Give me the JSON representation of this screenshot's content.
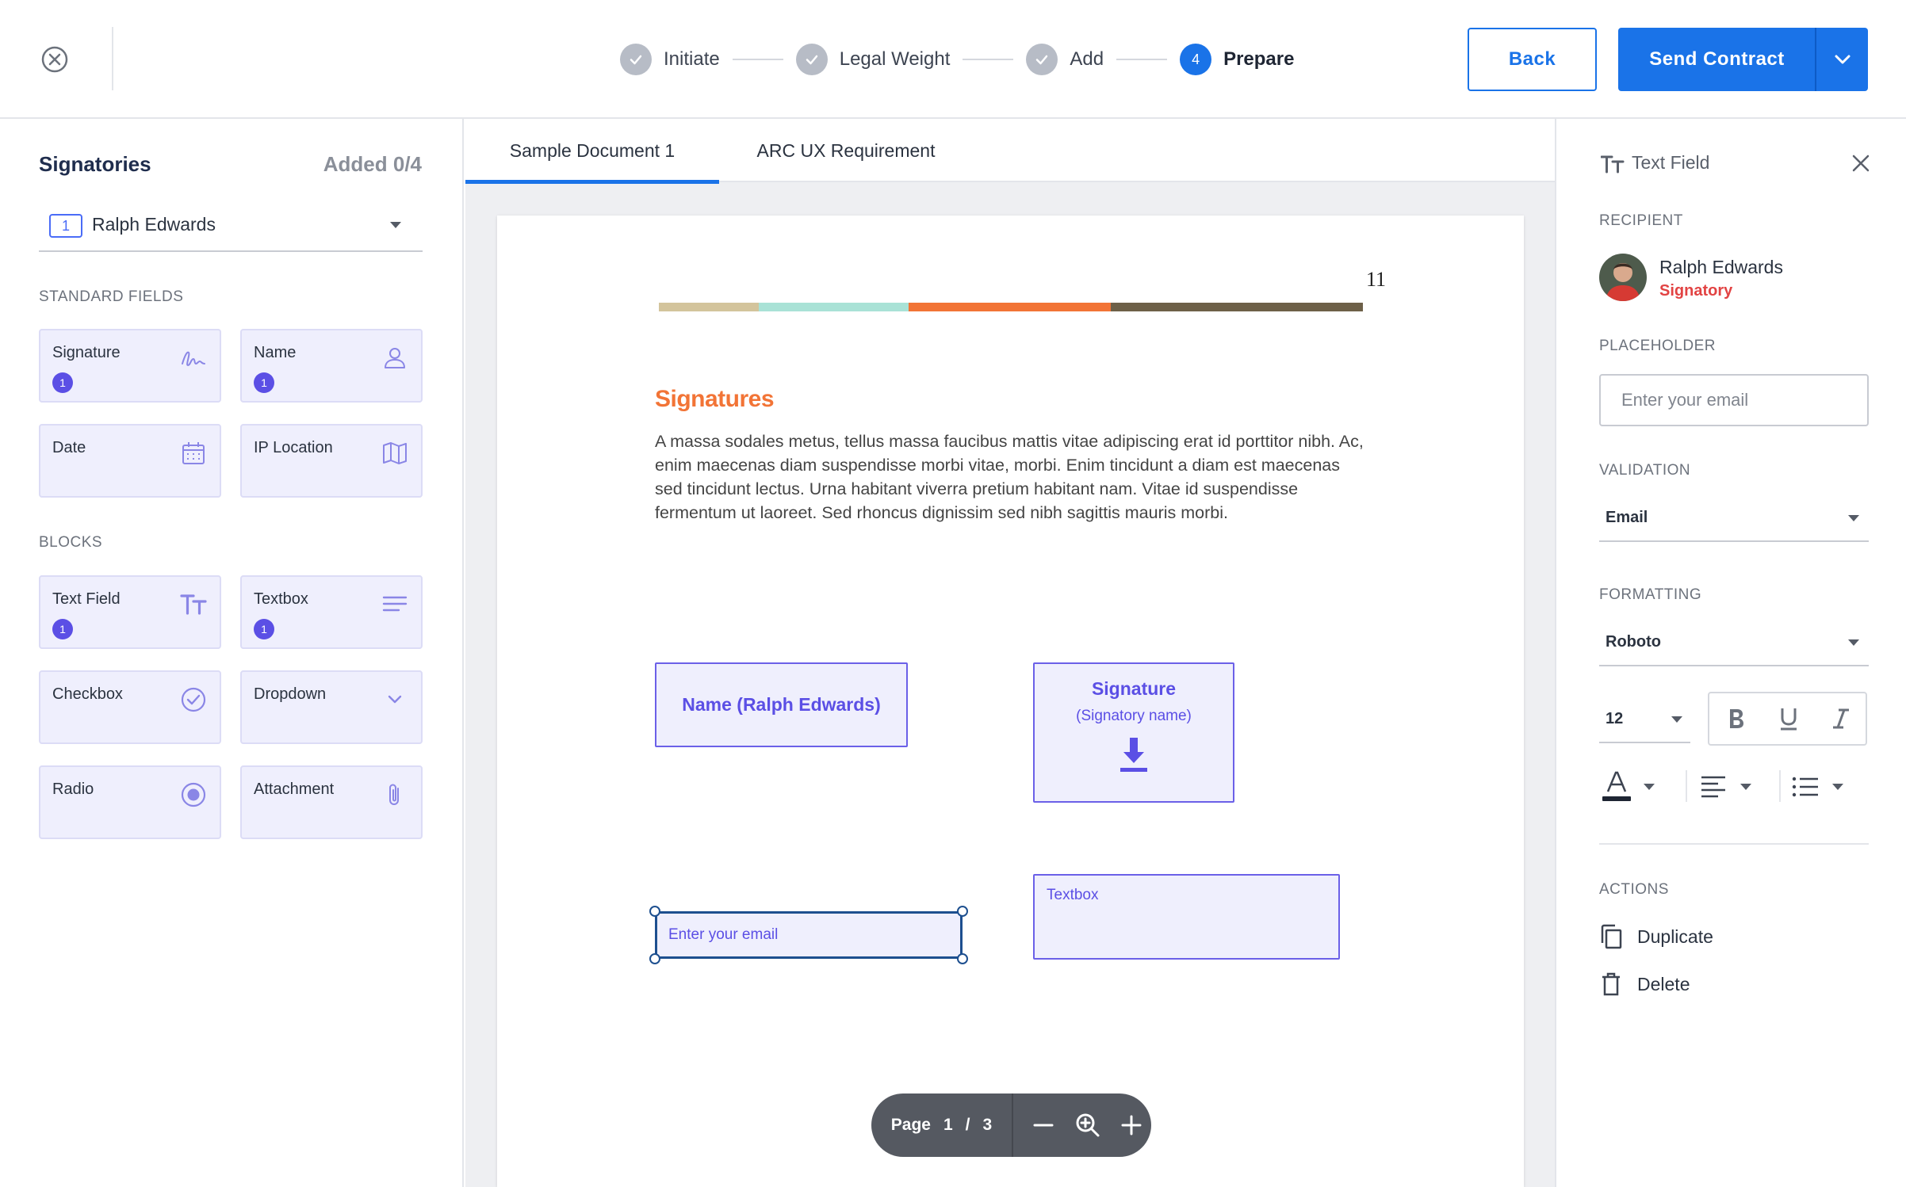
{
  "header": {
    "steps": [
      {
        "label": "Initiate",
        "state": "done"
      },
      {
        "label": "Legal Weight",
        "state": "done"
      },
      {
        "label": "Add",
        "state": "done"
      },
      {
        "label": "Prepare",
        "number": "4",
        "state": "active"
      }
    ],
    "back_label": "Back",
    "send_label": "Send Contract"
  },
  "sidebar": {
    "title": "Signatories",
    "added_count": "Added 0/4",
    "recipient": {
      "number": "1",
      "name": "Ralph Edwards"
    },
    "standard_label": "STANDARD FIELDS",
    "standard_fields": [
      {
        "label": "Signature",
        "icon": "signature-icon",
        "badge": "1"
      },
      {
        "label": "Name",
        "icon": "person-icon",
        "badge": "1"
      },
      {
        "label": "Date",
        "icon": "calendar-icon"
      },
      {
        "label": "IP Location",
        "icon": "map-icon"
      }
    ],
    "blocks_label": "BLOCKS",
    "blocks": [
      {
        "label": "Text Field",
        "icon": "text-field-icon",
        "badge": "1"
      },
      {
        "label": "Textbox",
        "icon": "lines-icon",
        "badge": "1"
      },
      {
        "label": "Checkbox",
        "icon": "check-circle-icon"
      },
      {
        "label": "Dropdown",
        "icon": "chevron-down-icon"
      },
      {
        "label": "Radio",
        "icon": "radio-icon"
      },
      {
        "label": "Attachment",
        "icon": "paperclip-icon"
      }
    ]
  },
  "document": {
    "tabs": [
      "Sample Document 1",
      "ARC UX Requirement"
    ],
    "active_tab": 0,
    "page_number": "11",
    "color_bar": [
      "#d3c49c",
      "#a9e2d6",
      "#f27436",
      "#6d6048"
    ],
    "heading": "Signatures",
    "body": "A massa sodales metus, tellus massa faucibus mattis vitae adipiscing erat id porttitor nibh. Ac, enim maecenas diam suspendisse morbi vitae, morbi. Enim tincidunt a diam est maecenas sed tincidunt lectus. Urna habitant viverra pretium habitant nam. Vitae id suspendisse fermentum ut laoreet. Sed rhoncus dignissim sed nibh sagittis mauris morbi.",
    "fields": {
      "name": "Name (Ralph Edwards)",
      "signature_title": "Signature",
      "signature_sub": "(Signatory name)",
      "textbox": "Textbox",
      "email": "Enter your email"
    },
    "pager": {
      "label": "Page",
      "current": "1",
      "separator": "/",
      "total": "3"
    }
  },
  "panel": {
    "title": "Text Field",
    "recipient_label": "RECIPIENT",
    "recipient_name": "Ralph Edwards",
    "recipient_role": "Signatory",
    "placeholder_label": "PLACEHOLDER",
    "placeholder_value": "Enter your email",
    "validation_label": "VALIDATION",
    "validation_value": "Email",
    "formatting_label": "FORMATTING",
    "font_value": "Roboto",
    "size_value": "12",
    "actions_label": "ACTIONS",
    "duplicate_label": "Duplicate",
    "delete_label": "Delete"
  },
  "colors": {
    "primary": "#1a73e8",
    "field_accent": "#5b4fe5",
    "heading_accent": "#f27436",
    "role_red": "#e24343"
  }
}
